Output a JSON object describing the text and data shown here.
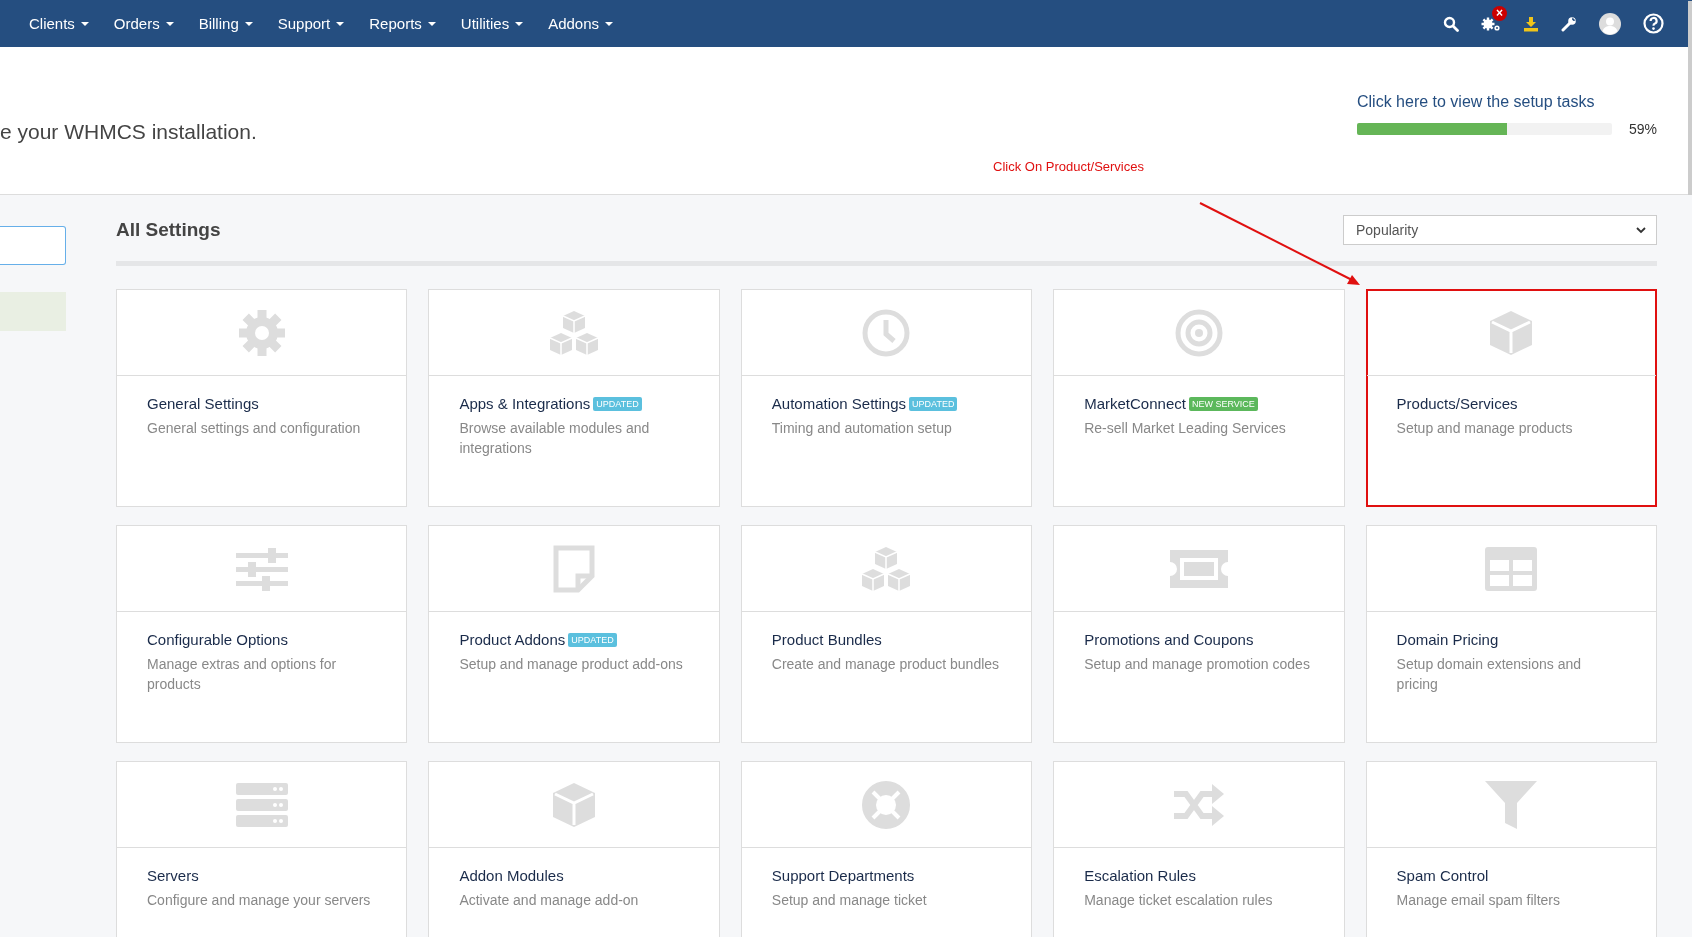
{
  "nav": {
    "items": [
      {
        "label": "Clients"
      },
      {
        "label": "Orders"
      },
      {
        "label": "Billing"
      },
      {
        "label": "Support"
      },
      {
        "label": "Reports"
      },
      {
        "label": "Utilities"
      },
      {
        "label": "Addons"
      }
    ],
    "alert_badge": "×"
  },
  "header": {
    "heading": "e your WHMCS installation.",
    "setup_link": "Click here to view the setup tasks",
    "setup_progress": {
      "level": 0.59,
      "reading": "59%"
    }
  },
  "annotation": {
    "text": "Click On Product/Services"
  },
  "settings": {
    "title": "All Settings",
    "sort": {
      "value": "Popularity"
    },
    "cards": [
      {
        "kind": "gear",
        "title": "General Settings",
        "description": "General settings and configuration",
        "highlighted": false
      },
      {
        "kind": "cubes",
        "title": "Apps & Integrations",
        "badge": {
          "text": "UPDATED",
          "color": "#5bc0de"
        },
        "description": "Browse available modules and integrations",
        "highlighted": false
      },
      {
        "kind": "clock",
        "title": "Automation Settings",
        "badge": {
          "text": "UPDATED",
          "color": "#5bc0de"
        },
        "description": "Timing and automation setup",
        "highlighted": false
      },
      {
        "kind": "target",
        "title": "MarketConnect",
        "badge": {
          "text": "NEW SERVICE",
          "color": "#5cb85c"
        },
        "description": "Re-sell Market Leading Services",
        "highlighted": false
      },
      {
        "kind": "box",
        "title": "Products/Services",
        "description": "Setup and manage products",
        "highlighted": true
      },
      {
        "kind": "sliders",
        "title": "Configurable Options",
        "description": "Manage extras and options for products",
        "highlighted": false
      },
      {
        "kind": "note",
        "title": "Product Addons",
        "badge": {
          "text": "UPDATED",
          "color": "#5bc0de"
        },
        "description": "Setup and manage product add-ons",
        "highlighted": false
      },
      {
        "kind": "cubes",
        "title": "Product Bundles",
        "description": "Create and manage product bundles",
        "highlighted": false
      },
      {
        "kind": "ticket",
        "title": "Promotions and Coupons",
        "description": "Setup and manage promotion codes",
        "highlighted": false
      },
      {
        "kind": "grid",
        "title": "Domain Pricing",
        "description": "Setup domain extensions and pricing",
        "highlighted": false
      },
      {
        "kind": "servers",
        "title": "Servers",
        "description": "Configure and manage your servers",
        "highlighted": false
      },
      {
        "kind": "box",
        "title": "Addon Modules",
        "description": "Activate and manage add-on",
        "highlighted": false
      },
      {
        "kind": "lifebuoy",
        "title": "Support Departments",
        "description": "Setup and manage ticket",
        "highlighted": false
      },
      {
        "kind": "shuffle",
        "title": "Escalation Rules",
        "description": "Manage ticket escalation rules",
        "highlighted": false
      },
      {
        "kind": "filter",
        "title": "Spam Control",
        "description": "Manage email spam filters",
        "highlighted": false
      }
    ]
  }
}
